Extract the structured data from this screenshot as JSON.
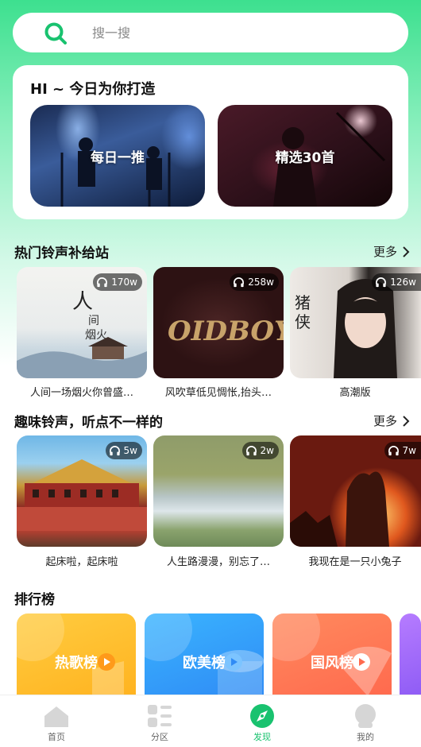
{
  "search": {
    "placeholder": "搜一搜"
  },
  "today": {
    "greeting": "HI ~ 今日为你打造",
    "cards": [
      {
        "label": "每日一推"
      },
      {
        "label": "精选30首"
      }
    ]
  },
  "hot": {
    "title": "热门铃声补给站",
    "more": "更多",
    "items": [
      {
        "count": "170w",
        "caption": "人间一场烟火你曾盛…"
      },
      {
        "count": "258w",
        "caption": "风吹草低见惆怅,抬头…"
      },
      {
        "count": "126w",
        "caption": "高潮版"
      }
    ]
  },
  "fun": {
    "title": "趣味铃声，听点不一样的",
    "more": "更多",
    "items": [
      {
        "count": "5w",
        "caption": "起床啦，起床啦"
      },
      {
        "count": "2w",
        "caption": "人生路漫漫，别忘了…"
      },
      {
        "count": "7w",
        "caption": "我现在是一只小兔子"
      }
    ]
  },
  "ranking": {
    "title": "排行榜",
    "items": [
      {
        "label": "热歌榜"
      },
      {
        "label": "欧美榜"
      },
      {
        "label": "国风榜"
      }
    ]
  },
  "tabs": [
    {
      "label": "首页"
    },
    {
      "label": "分区"
    },
    {
      "label": "发现"
    },
    {
      "label": "我的"
    }
  ],
  "colors": {
    "accent": "#19c26f",
    "header_green": "#3de08f"
  }
}
